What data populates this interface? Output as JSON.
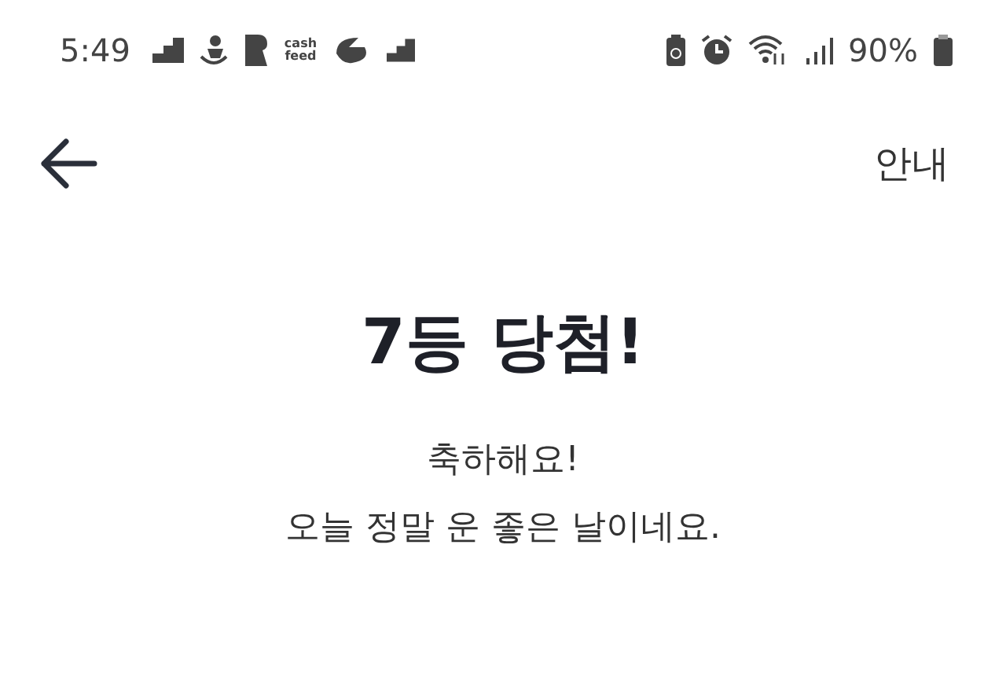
{
  "status_bar": {
    "time": "5:49",
    "app_icon_text": [
      "cash",
      "feed"
    ],
    "battery": "90%"
  },
  "header": {
    "action": "안내"
  },
  "result": {
    "title": "7등 당첨!",
    "lines": [
      "축하해요!",
      "오늘 정말 운 좋은 날이네요."
    ]
  }
}
